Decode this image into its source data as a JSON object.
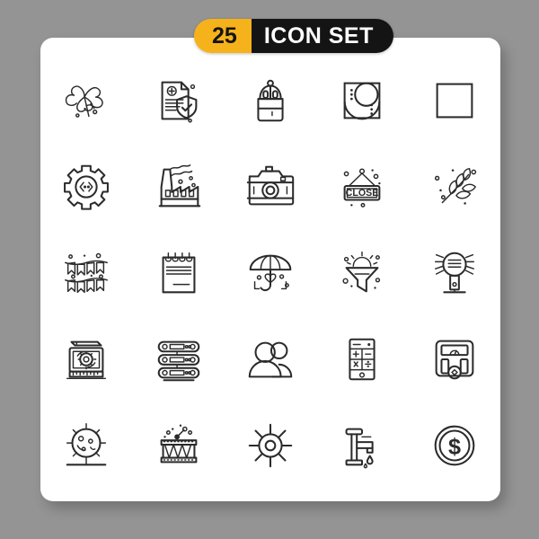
{
  "page": {
    "background_color": "#949494",
    "card_color": "#ffffff"
  },
  "header": {
    "count": "25",
    "title": "ICON SET",
    "badge_accent_color": "#F6B21B",
    "badge_dark_color": "#141414",
    "badge_text_color": "#ffffff"
  },
  "grid": {
    "columns": 5,
    "rows": 5,
    "total": 25,
    "stroke_color": "#2b2b2b",
    "style": "line"
  },
  "icons": [
    {
      "id": 1,
      "name": "four-leaf-clover-icon",
      "label": "Four Leaf Clover"
    },
    {
      "id": 2,
      "name": "medical-report-shield-icon",
      "label": "Medical Report Protection"
    },
    {
      "id": 3,
      "name": "backpack-icon",
      "label": "Backpack"
    },
    {
      "id": 4,
      "name": "abstract-geometric-square-icon",
      "label": "Abstract Composition"
    },
    {
      "id": 5,
      "name": "empty-square-icon",
      "label": "Square"
    },
    {
      "id": 6,
      "name": "gear-code-icon",
      "label": "Development Settings"
    },
    {
      "id": 7,
      "name": "factory-icon",
      "label": "Factory"
    },
    {
      "id": 8,
      "name": "camera-icon",
      "label": "Camera"
    },
    {
      "id": 9,
      "name": "close-sign-icon",
      "label": "Close Sign",
      "sign_text": "CLOSE"
    },
    {
      "id": 10,
      "name": "wheat-branch-icon",
      "label": "Wheat Branch"
    },
    {
      "id": 11,
      "name": "bunting-flags-icon",
      "label": "Bunting Flags"
    },
    {
      "id": 12,
      "name": "spiral-notepad-icon",
      "label": "Notepad"
    },
    {
      "id": 13,
      "name": "umbrella-heart-icon",
      "label": "Umbrella Love"
    },
    {
      "id": 14,
      "name": "funnel-sun-icon",
      "label": "Solar Funnel"
    },
    {
      "id": 15,
      "name": "magnifier-lamp-icon",
      "label": "Magnifier Lamp"
    },
    {
      "id": 16,
      "name": "design-gear-pencil-icon",
      "label": "Graphic Design"
    },
    {
      "id": 17,
      "name": "server-rack-icon",
      "label": "Server Rack"
    },
    {
      "id": 18,
      "name": "users-group-icon",
      "label": "Users Group"
    },
    {
      "id": 19,
      "name": "calculator-icon",
      "label": "Calculator"
    },
    {
      "id": 20,
      "name": "weight-scale-icon",
      "label": "Weighing Scale"
    },
    {
      "id": 21,
      "name": "virus-cell-icon",
      "label": "Virus Cell"
    },
    {
      "id": 22,
      "name": "drum-icon",
      "label": "Drum"
    },
    {
      "id": 23,
      "name": "sun-icon",
      "label": "Sun"
    },
    {
      "id": 24,
      "name": "water-faucet-icon",
      "label": "Water Faucet"
    },
    {
      "id": 25,
      "name": "dollar-coin-icon",
      "label": "Dollar Coin",
      "currency_symbol": "$"
    }
  ]
}
